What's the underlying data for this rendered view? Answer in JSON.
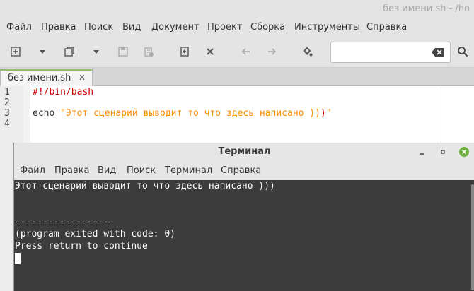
{
  "window": {
    "title": "без имени.sh - /ho"
  },
  "menu": [
    "Файл",
    "Правка",
    "Поиск",
    "Вид",
    "Документ",
    "Проект",
    "Сборка",
    "Инструменты",
    "Справка"
  ],
  "toolbar": {
    "search_value": ""
  },
  "icons": [
    "new-file-icon",
    "dropdown-icon",
    "open-file-icon",
    "save-icon",
    "save-all-icon",
    "revert-icon",
    "close-icon",
    "back-arrow-icon",
    "forward-arrow-icon",
    "compile-icon",
    "clear-input-icon",
    "search-icon"
  ],
  "tab": {
    "label": "без имени.sh",
    "close": "✕"
  },
  "editor": {
    "line_numbers": [
      "1",
      "2",
      "3",
      "4"
    ],
    "shebang": "#!/bin/bash",
    "keyword": "echo",
    "string_open": " \"Этот сценарий выводит то что здесь написано ))",
    "string_paren": ")",
    "string_close": "\""
  },
  "terminal": {
    "title": "Терминал",
    "menu": [
      "Файл",
      "Правка",
      "Вид",
      "Поиск",
      "Терминал",
      "Справка"
    ],
    "lines": [
      "Этот сценарий выводит то что здесь написано )))",
      "",
      "",
      "------------------",
      "(program exited with code: 0)",
      "Press return to continue"
    ]
  },
  "colors": {
    "shebang": "#cc0000",
    "string": "#ff8c00",
    "terminal_bg": "#3c3c3c",
    "close_button": "#6db33f"
  }
}
